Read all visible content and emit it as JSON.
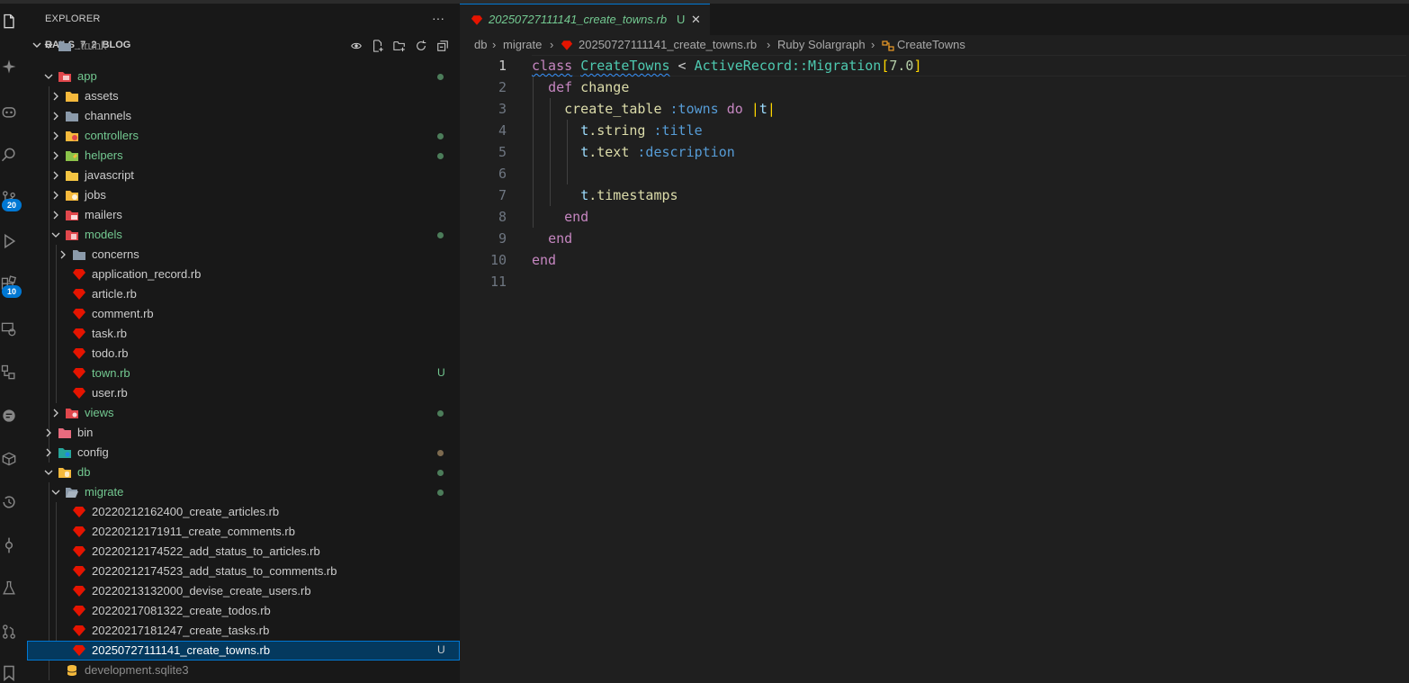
{
  "activity_bar": {
    "icons": [
      "files-icon",
      "sparkle-icon",
      "copilot-icon",
      "search-icon",
      "source-control-icon",
      "run-debug-icon",
      "extensions-icon",
      "remote-explorer-icon",
      "git-graph-icon",
      "chat-icon",
      "database-icon",
      "timeline-icon",
      "git-commit-icon",
      "testing-icon",
      "git-pull-request-icon",
      "bookmark-icon"
    ],
    "source_control_badge": "20",
    "extensions_badge": "10"
  },
  "sidebar": {
    "title": "EXPLORER",
    "more": "···",
    "project": "RAILS_7_2_BLOG",
    "tree": {
      "trunk": ".trunk",
      "app": "app",
      "assets": "assets",
      "channels": "channels",
      "controllers": "controllers",
      "helpers": "helpers",
      "javascript": "javascript",
      "jobs": "jobs",
      "mailers": "mailers",
      "models": "models",
      "concerns": "concerns",
      "application_record": "application_record.rb",
      "article": "article.rb",
      "comment": "comment.rb",
      "task": "task.rb",
      "todo": "todo.rb",
      "town": "town.rb",
      "user": "user.rb",
      "views": "views",
      "bin": "bin",
      "config": "config",
      "db": "db",
      "migrate": "migrate",
      "m1": "20220212162400_create_articles.rb",
      "m2": "20220212171911_create_comments.rb",
      "m3": "20220212174522_add_status_to_articles.rb",
      "m4": "20220212174523_add_status_to_comments.rb",
      "m5": "20220213132000_devise_create_users.rb",
      "m6": "20220217081322_create_todos.rb",
      "m7": "20220217181247_create_tasks.rb",
      "m8": "20250727111141_create_towns.rb",
      "devdb": "development.sqlite3",
      "untracked": "U"
    }
  },
  "editor": {
    "tab": {
      "label": "20250727111141_create_towns.rb",
      "status": "U",
      "close": "✕"
    },
    "breadcrumbs": {
      "db": "db",
      "migrate": "migrate",
      "file": "20250727111141_create_towns.rb",
      "solargraph": "Ruby Solargraph",
      "symbol": "CreateTowns",
      "sep": "›"
    },
    "line_numbers": [
      "1",
      "2",
      "3",
      "4",
      "5",
      "6",
      "7",
      "8",
      "9",
      "10",
      "11"
    ],
    "code": {
      "l1": {
        "kw": "class",
        "cls": "CreateTowns",
        "op": " < ",
        "base": "ActiveRecord::Migration",
        "ob": "[",
        "num": "7.0",
        "cb": "]"
      },
      "l2": {
        "kw": "def",
        "name": " change"
      },
      "l3": {
        "fn": "create_table",
        "sym": ":towns",
        "kw": "do",
        "bar1": "|",
        "arg": "t",
        "bar2": "|"
      },
      "l4": {
        "recv": "t",
        "meth": ".string",
        "sym": ":title"
      },
      "l5": {
        "recv": "t",
        "meth": ".text",
        "sym": ":description"
      },
      "l7": {
        "recv": "t",
        "meth": ".timestamps"
      },
      "l8": {
        "kw": "end"
      },
      "l9": {
        "kw": "end"
      },
      "l10": {
        "kw": "end"
      }
    }
  },
  "colors": {
    "accent": "#0078d4",
    "untracked_green": "#73c991",
    "ruby_red": "#e51400"
  }
}
